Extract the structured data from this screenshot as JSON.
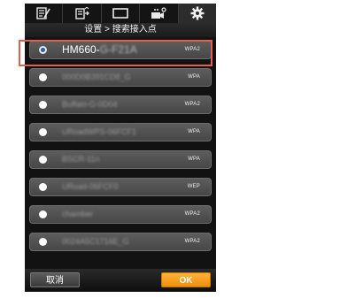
{
  "tabs": [
    {
      "icon": "edit-icon",
      "active": false
    },
    {
      "icon": "export-icon",
      "active": false
    },
    {
      "icon": "screen-icon",
      "active": false
    },
    {
      "icon": "camera-settings-icon",
      "active": false
    },
    {
      "icon": "gear-icon",
      "active": true
    }
  ],
  "header": {
    "title": "设置 > 搜索接入点"
  },
  "networks": [
    {
      "ssid_prefix": "HM660-",
      "ssid_blur": "G-F21A",
      "security": "WPA2",
      "selected": true
    },
    {
      "ssid_prefix": "",
      "ssid_blur": "000D0B391CD8_G",
      "security": "WPA",
      "selected": false
    },
    {
      "ssid_prefix": "",
      "ssid_blur": "Buffalo-G-0D04",
      "security": "WPA2",
      "selected": false
    },
    {
      "ssid_prefix": "",
      "ssid_blur": "URoadWPS-06FCF1",
      "security": "WPA",
      "selected": false
    },
    {
      "ssid_prefix": "",
      "ssid_blur": "BSCR-11n",
      "security": "WPA",
      "selected": false
    },
    {
      "ssid_prefix": "",
      "ssid_blur": "URoad-06FCF0",
      "security": "WEP",
      "selected": false
    },
    {
      "ssid_prefix": "",
      "ssid_blur": "chamber",
      "security": "WPA2",
      "selected": false
    },
    {
      "ssid_prefix": "",
      "ssid_blur": "0024A5C1716E_G",
      "security": "WPA2",
      "selected": false
    }
  ],
  "buttons": {
    "cancel": "取消",
    "ok": "OK"
  },
  "colors": {
    "highlight": "#e36050",
    "ok_button": "#f7a020",
    "selected_radio": "#2a63a8"
  }
}
